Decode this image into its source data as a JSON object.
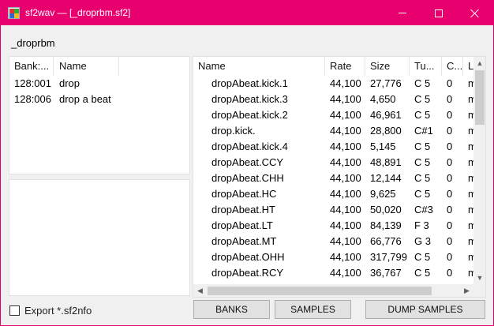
{
  "window": {
    "title": "sf2wav — [_droprbm.sf2]",
    "accent": "#e8006f"
  },
  "file_label": "_droprbm",
  "banks": {
    "columns": [
      "Bank:...",
      "Name"
    ],
    "rows": [
      {
        "bank": "128:001",
        "name": "drop"
      },
      {
        "bank": "128:006",
        "name": "drop a beat"
      }
    ]
  },
  "samples": {
    "columns": [
      "Name",
      "Rate",
      "Size",
      "Tu...",
      "C...",
      "Li"
    ],
    "rows": [
      {
        "name": "dropAbeat.kick.1",
        "rate": "44,100",
        "size": "27,776",
        "tune": "C 5",
        "c": "0",
        "li": "m"
      },
      {
        "name": "dropAbeat.kick.3",
        "rate": "44,100",
        "size": "4,650",
        "tune": "C 5",
        "c": "0",
        "li": "m"
      },
      {
        "name": "dropAbeat.kick.2",
        "rate": "44,100",
        "size": "46,961",
        "tune": "C 5",
        "c": "0",
        "li": "m"
      },
      {
        "name": "drop.kick.",
        "rate": "44,100",
        "size": "28,800",
        "tune": "C#1",
        "c": "0",
        "li": "m"
      },
      {
        "name": "dropAbeat.kick.4",
        "rate": "44,100",
        "size": "5,145",
        "tune": "C 5",
        "c": "0",
        "li": "m"
      },
      {
        "name": "dropAbeat.CCY",
        "rate": "44,100",
        "size": "48,891",
        "tune": "C 5",
        "c": "0",
        "li": "m"
      },
      {
        "name": "dropAbeat.CHH",
        "rate": "44,100",
        "size": "12,144",
        "tune": "C 5",
        "c": "0",
        "li": "m"
      },
      {
        "name": "dropAbeat.HC",
        "rate": "44,100",
        "size": "9,625",
        "tune": "C 5",
        "c": "0",
        "li": "m"
      },
      {
        "name": "dropAbeat.HT",
        "rate": "44,100",
        "size": "50,020",
        "tune": "C#3",
        "c": "0",
        "li": "m"
      },
      {
        "name": "dropAbeat.LT",
        "rate": "44,100",
        "size": "84,139",
        "tune": "F 3",
        "c": "0",
        "li": "m"
      },
      {
        "name": "dropAbeat.MT",
        "rate": "44,100",
        "size": "66,776",
        "tune": "G 3",
        "c": "0",
        "li": "m"
      },
      {
        "name": "dropAbeat.OHH",
        "rate": "44,100",
        "size": "317,799",
        "tune": "C 5",
        "c": "0",
        "li": "m"
      },
      {
        "name": "dropAbeat.RCY",
        "rate": "44,100",
        "size": "36,767",
        "tune": "C 5",
        "c": "0",
        "li": "m"
      }
    ]
  },
  "icons": {
    "app": "app-icon",
    "scroll_up": "▲",
    "scroll_down": "▼",
    "scroll_left": "◀",
    "scroll_right": "▶"
  },
  "export_checkbox": {
    "label": "Export *.sf2nfo",
    "checked": false
  },
  "buttons": {
    "banks": "BANKS",
    "samples": "SAMPLES",
    "dump": "DUMP SAMPLES"
  }
}
